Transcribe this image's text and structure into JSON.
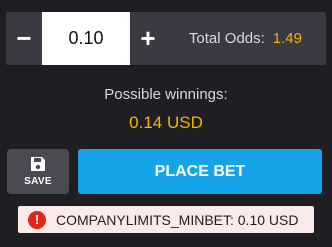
{
  "stake": {
    "decrement_label": "−",
    "value": "0.10",
    "increment_label": "+"
  },
  "odds": {
    "label": "Total Odds:",
    "value": "1.49"
  },
  "winnings": {
    "label": "Possible winnings:",
    "value": "0.14 USD"
  },
  "actions": {
    "save_label": "SAVE",
    "place_bet_label": "PLACE BET"
  },
  "error": {
    "icon": "!",
    "message": "COMPANYLIMITS_MINBET: 0.10 USD"
  },
  "colors": {
    "background": "#1f1f23",
    "accent": "#f5b400",
    "primary_button": "#16a4e8",
    "error": "#e0261d"
  }
}
